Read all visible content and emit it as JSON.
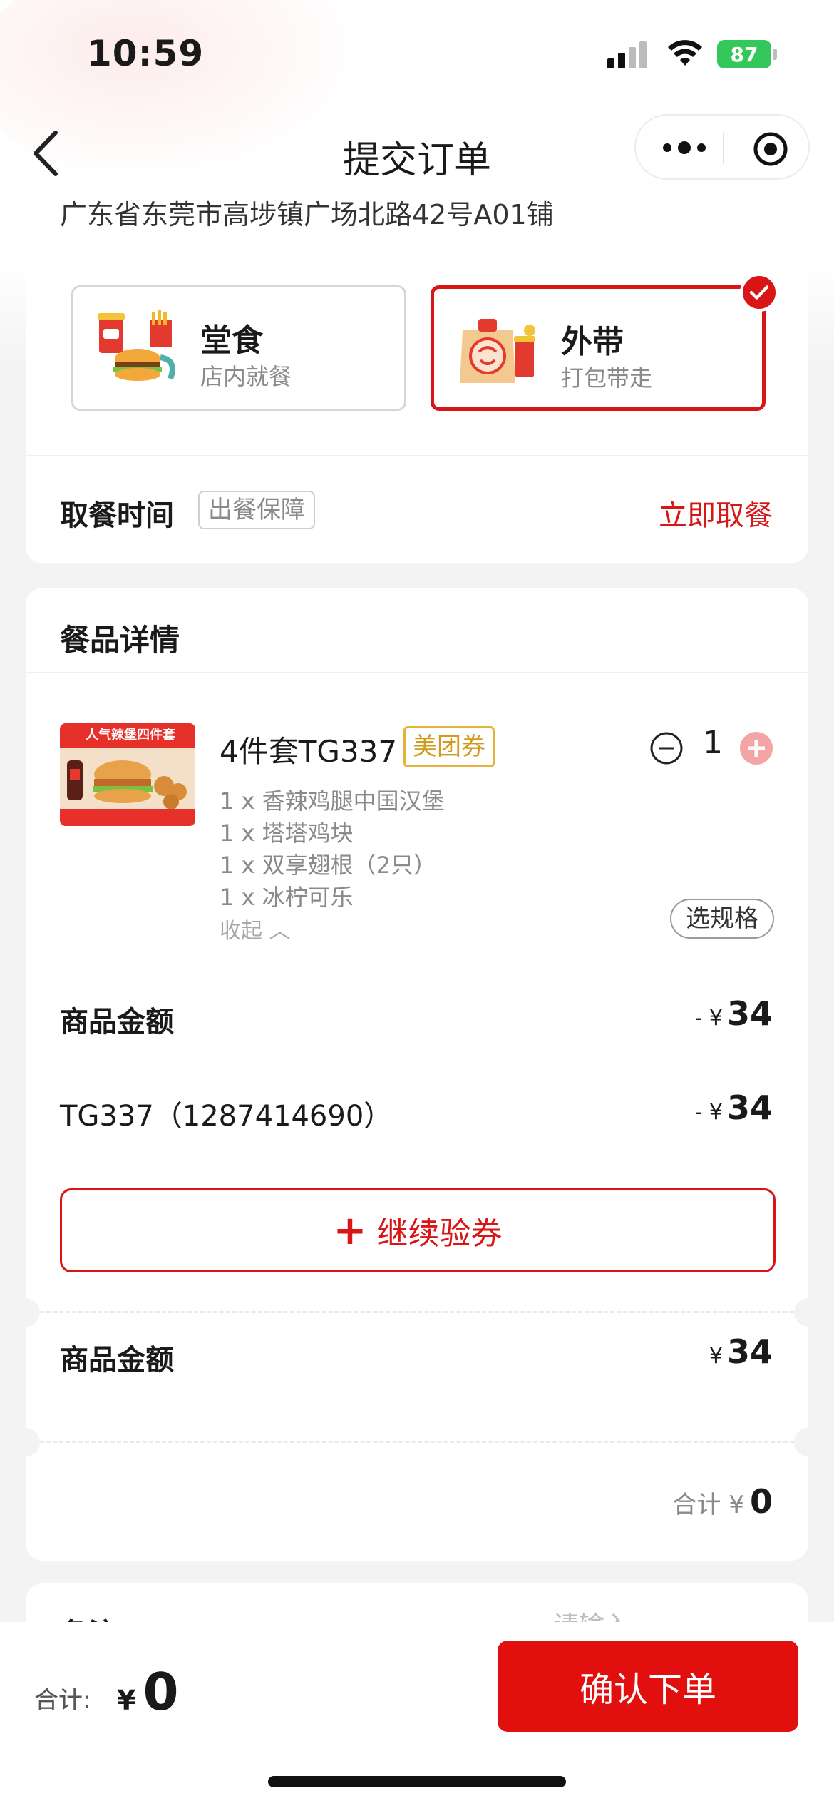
{
  "status": {
    "time": "10:59",
    "battery": "87"
  },
  "nav": {
    "title": "提交订单"
  },
  "store": {
    "address": "广东省东莞市高埗镇广场北路42号A01铺"
  },
  "order_type": {
    "options": [
      {
        "title": "堂食",
        "subtitle": "店内就餐",
        "selected": false
      },
      {
        "title": "外带",
        "subtitle": "打包带走",
        "selected": true
      }
    ]
  },
  "pickup": {
    "label": "取餐时间",
    "tag": "出餐保障",
    "value": "立即取餐"
  },
  "items_section": {
    "title": "餐品详情",
    "item": {
      "image_caption": "人气辣堡四件套",
      "name": "4件套TG337",
      "coupon_tag": "美团券",
      "quantity": "1",
      "sub_items": [
        "1 x 香辣鸡腿中国汉堡",
        "1 x 塔塔鸡块",
        "1 x 双享翅根（2只）",
        "1 x 冰柠可乐"
      ],
      "collapse_label": "收起 ︿",
      "spec_button": "选规格"
    },
    "amount_row": {
      "label": "商品金额",
      "prefix": "- ¥",
      "value": "34"
    },
    "coupon_row": {
      "label": "TG337（1287414690）",
      "prefix": "- ¥",
      "value": "34"
    },
    "continue_button": {
      "plus": "+",
      "label": "继续验券"
    },
    "subtotal_row": {
      "label": "商品金额",
      "prefix": "¥",
      "value": "34"
    },
    "total_row": {
      "prefix": "合计 ¥",
      "value": "0"
    }
  },
  "remark": {
    "label": "备注",
    "placeholder": "请输入"
  },
  "bottom_bar": {
    "label": "合计:",
    "currency": "¥",
    "amount": "0",
    "confirm": "确认下单"
  },
  "colors": {
    "accent": "#d91616",
    "confirm_bg": "#e20f0f",
    "coupon": "#e3b33a",
    "battery": "#34c759"
  }
}
